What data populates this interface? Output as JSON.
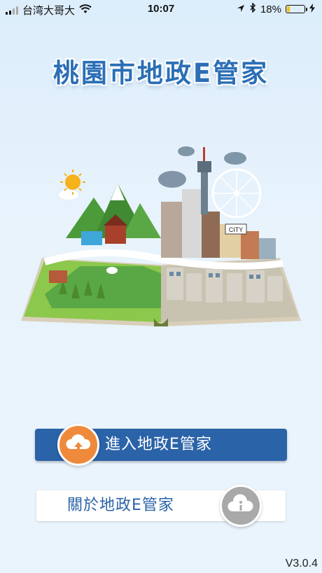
{
  "status_bar": {
    "carrier": "台湾大哥大",
    "time": "10:07",
    "battery_percent": "18%",
    "battery_level": 0.18,
    "icons": [
      "signal-icon",
      "wifi-icon",
      "location-arrow-icon",
      "bluetooth-icon",
      "battery-icon",
      "charging-bolt-icon"
    ]
  },
  "app": {
    "title": "桃園市地政E管家",
    "title_color": "#2b6fb6"
  },
  "buttons": {
    "enter": {
      "label": "進入地政E管家",
      "icon": "cloud-upload-icon",
      "color": "#2b63a8",
      "icon_color": "#ef8a3c"
    },
    "about": {
      "label": "關於地政E管家",
      "icon": "info-cloud-icon",
      "color": "#ffffff",
      "icon_color": "#a9a9a9"
    }
  },
  "version": "V3.0.4",
  "illustration": {
    "icon": "pop-up-book-city-icon",
    "sign_text": "CITY"
  }
}
